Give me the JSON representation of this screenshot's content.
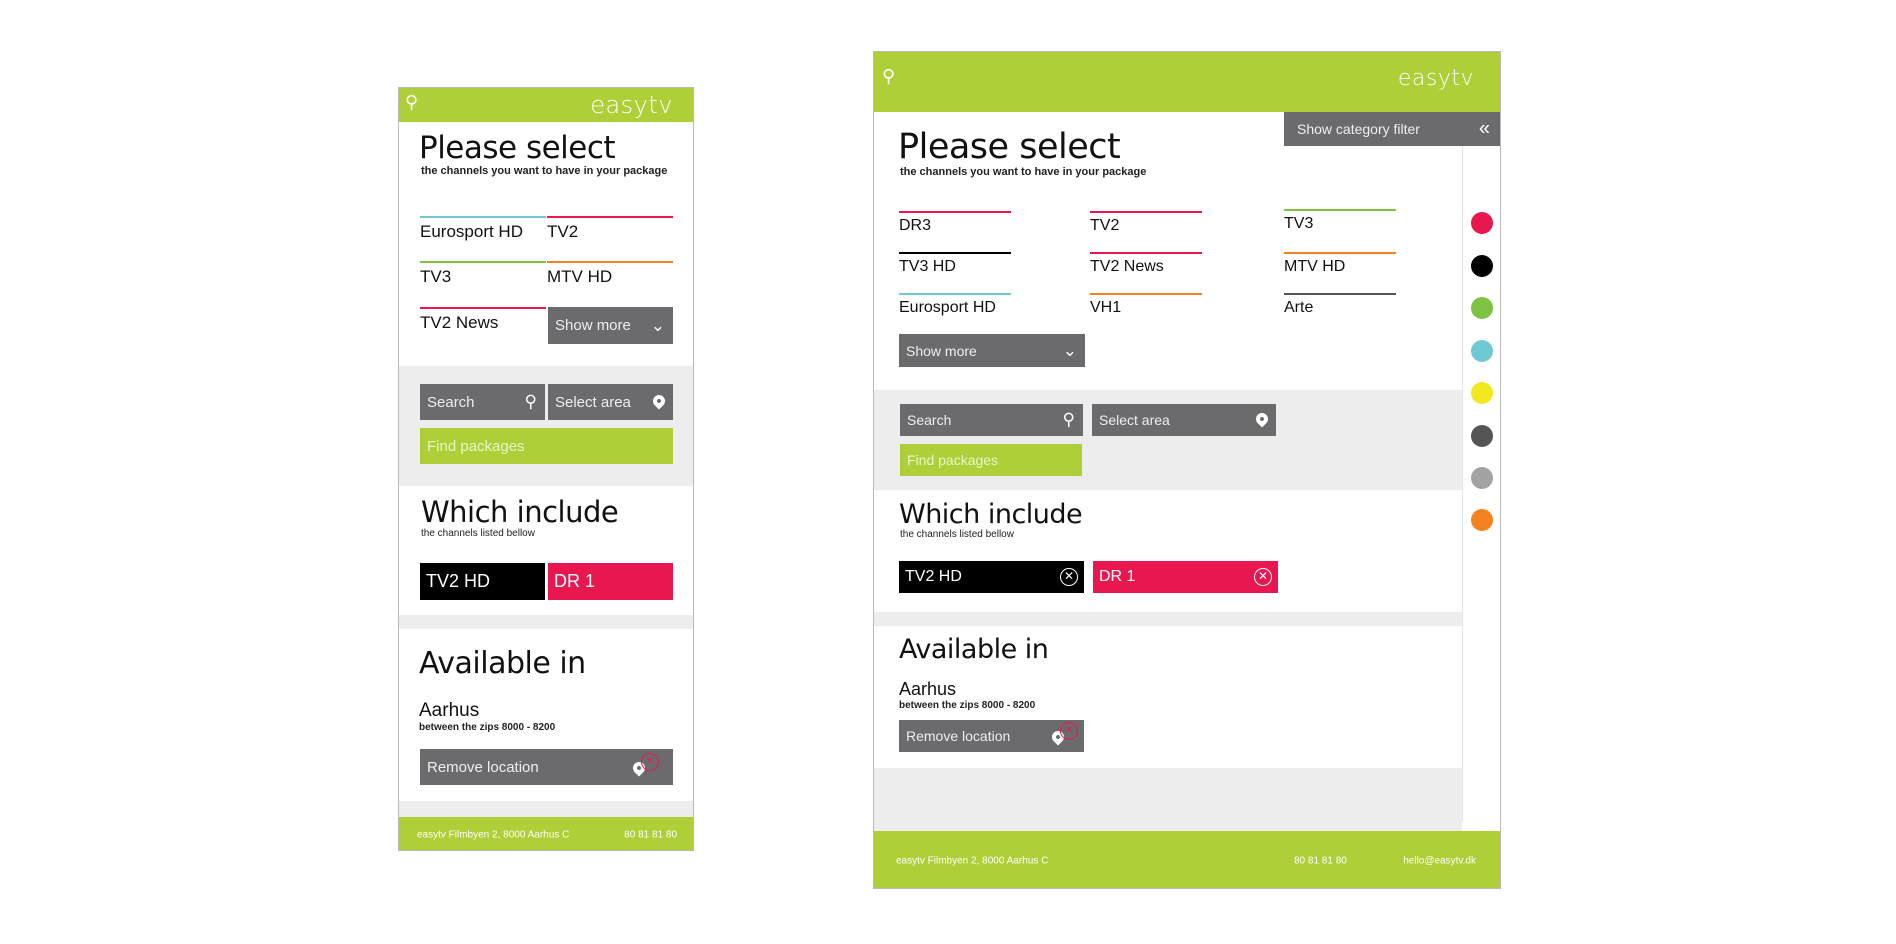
{
  "brand": "easytv",
  "colors": {
    "accent": "#aecf38",
    "dark_button": "#6b6b6e",
    "pink": "#e8174f",
    "black": "#000000",
    "panel_gray": "#ecedec"
  },
  "select": {
    "title": "Please select",
    "subtitle": "the channels you want to have in your package",
    "show_more": "Show more"
  },
  "mobile": {
    "channels": [
      {
        "name": "Eurosport HD",
        "color": "#6ec9d4"
      },
      {
        "name": "TV2",
        "color": "#e8174f"
      },
      {
        "name": "TV3",
        "color": "#7dc242"
      },
      {
        "name": "MTV HD",
        "color": "#f58220"
      },
      {
        "name": "TV2 News",
        "color": "#e8174f"
      }
    ]
  },
  "desktop": {
    "channels": [
      {
        "name": "DR3",
        "color": "#e8174f"
      },
      {
        "name": "TV2",
        "color": "#e8174f"
      },
      {
        "name": "TV3",
        "color": "#7dc242"
      },
      {
        "name": "TV3 HD",
        "color": "#000000"
      },
      {
        "name": "TV2 News",
        "color": "#e8174f"
      },
      {
        "name": "MTV HD",
        "color": "#f58220"
      },
      {
        "name": "Eurosport HD",
        "color": "#6ec9d4"
      },
      {
        "name": "VH1",
        "color": "#f58220"
      },
      {
        "name": "Arte",
        "color": "#555555"
      }
    ],
    "category_filter": "Show category filter",
    "category_colors": [
      "#e8174f",
      "#000000",
      "#7dc242",
      "#6ec9d4",
      "#f2e81f",
      "#555555",
      "#a3a3a3",
      "#f58220"
    ]
  },
  "search": {
    "search_label": "Search",
    "area_label": "Select area",
    "find_label": "Find packages"
  },
  "include": {
    "title": "Which include",
    "subtitle": "the channels listed bellow",
    "chips": [
      {
        "name": "TV2 HD",
        "color": "#000000"
      },
      {
        "name": "DR 1",
        "color": "#e8174f"
      }
    ]
  },
  "available": {
    "title": "Available in",
    "city": "Aarhus",
    "zips": "between the zips 8000 - 8200",
    "remove_label": "Remove location"
  },
  "footer": {
    "address": "easytv  Filmbyen 2, 8000 Aarhus C",
    "phone": "80 81 81 80",
    "email": "hello@easytv.dk"
  }
}
